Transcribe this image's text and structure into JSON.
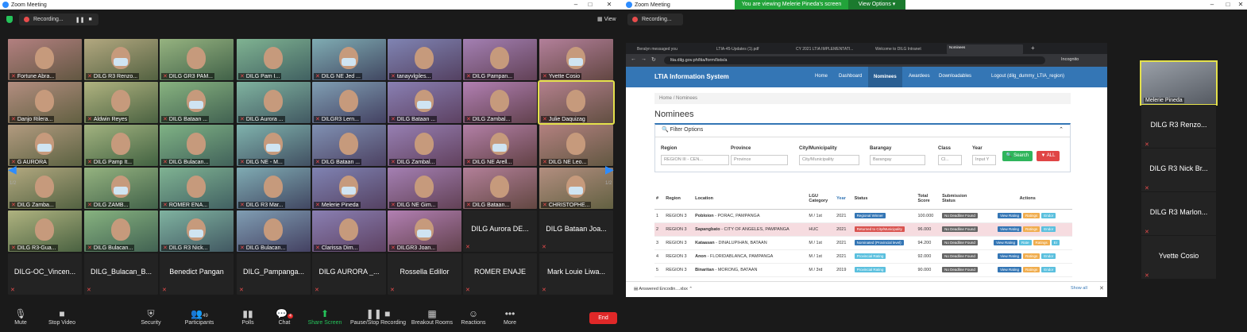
{
  "left": {
    "title": "Zoom Meeting",
    "recording": "Recording...",
    "view": "View",
    "page_left": "1/2",
    "page_right": "1/2",
    "video_tiles": [
      "Fortune Abra...",
      "DILG R3 Renzo...",
      "DILG GR3 PAM...",
      "DILG Pam I...",
      "DILG NE Jed ...",
      "tanayvlgiles...",
      "DILG Pampan...",
      "Yvette Cosio",
      "Danjo Rilera...",
      "Aldwin Reyes",
      "DILG Bataan ...",
      "DILG Aurora ...",
      "DILGR3 Lern...",
      "DILG Bataan ...",
      "DILG Zambal...",
      "Julie Daquizag",
      "G AURORA",
      "DILG Pamp It...",
      "DILG Bulacan...",
      "DILG NE - M...",
      "DILG Bataan ...",
      "DILG Zambal...",
      "DILG NE Arell...",
      "DILG NE Leo...",
      "DILG Zamba...",
      "DILG ZAMB...",
      "ROMER ENA...",
      "DILG R3 Mar...",
      "Melerie Pineda",
      "DILG NE Gim...",
      "DILG Bataan...",
      "CHRISTOPHE...",
      "DILG R3-Gua...",
      "DILG Bulacan...",
      "DILG R3 Nick...",
      "DILG Bulacan...",
      "Clarissa Dim...",
      "DILGR3 Joan..."
    ],
    "name_tiles": [
      "DILG Aurora DE...",
      "DILG Bataan Joa...",
      "DILG-OC_Vincen...",
      "DILG_Bulacan_B...",
      "Benedict Pangan",
      "DILG_Pampanga...",
      "DILG AURORA _...",
      "Rossella Edillor",
      "ROMER ENAJE",
      "Mark Louie Liwa..."
    ],
    "toolbar": {
      "mute": "Mute",
      "stop_video": "Stop Video",
      "security": "Security",
      "participants": "Participants",
      "participants_count": "49",
      "polls": "Polls",
      "chat": "Chat",
      "chat_badge": "4",
      "share_screen": "Share Screen",
      "pause_recording": "Pause/Stop Recording",
      "breakout": "Breakout Rooms",
      "reactions": "Reactions",
      "more": "More",
      "end": "End"
    }
  },
  "right": {
    "title": "Zoom Meeting",
    "recording": "Recording...",
    "banner": "You are viewing Melerie Pineda's screen",
    "view_options": "View Options",
    "browser": {
      "tabs": [
        "Beralyn messaged you",
        "LTIA-45-Updates (1).pdf",
        "CY 2021 LTIA IMPLEMENTATI...",
        "Welcome to DILG Intranet",
        "Nominees"
      ],
      "url": "ltia.dilg.gov.ph/ltia/form/lists/a",
      "incognito": "Incognito",
      "brand": "LTIA Information System",
      "nav": [
        "Home",
        "Dashboard",
        "Nominees",
        "Awardees",
        "Downloadables",
        "Logout (dilg_dummy_LTIA_region)"
      ],
      "breadcrumb": [
        "Home",
        "/",
        "Nominees"
      ],
      "heading": "Nominees",
      "filter_title": "Filter Options",
      "filters": [
        {
          "label": "Region",
          "value": "REGION III - CEN..."
        },
        {
          "label": "Province",
          "value": "Province"
        },
        {
          "label": "City/Municipality",
          "value": "City/Municipality"
        },
        {
          "label": "Barangay",
          "value": "Barangay"
        },
        {
          "label": "Class",
          "value": "Cl..."
        },
        {
          "label": "Year",
          "value": "Input Y"
        }
      ],
      "search_btn": "Search",
      "all_btn": "ALL",
      "columns": [
        "#",
        "Region",
        "Location",
        "LGU Category",
        "Year",
        "Status",
        "Total Score",
        "Submission Status",
        "Actions"
      ],
      "rows": [
        {
          "n": "1",
          "region": "REGION 3",
          "loc_bold": "Pobloion",
          "loc": " - PORAC, PAMPANGA",
          "cat": "M / 1st",
          "year": "2021",
          "status": "Regional Winner",
          "status_color": "#3476b5",
          "score": "100.000",
          "sub": "No Deadline Found",
          "actions": [
            "View Rating",
            "Ratings",
            "Endor"
          ]
        },
        {
          "n": "2",
          "region": "REGION 3",
          "loc_bold": "Sapangbato",
          "loc": " - CITY OF ANGELES, PAMPANGA",
          "cat": "HUC",
          "year": "2021",
          "status": "Returned to City/Municipality",
          "status_color": "#d9534f",
          "score": "96.000",
          "sub": "No Deadline Found",
          "actions": [
            "View Rating",
            "Ratings",
            "Endor"
          ]
        },
        {
          "n": "3",
          "region": "REGION 3",
          "loc_bold": "Kataasan",
          "loc": " - DINALUPIHAN, BATAAN",
          "cat": "M / 1st",
          "year": "2021",
          "status": "Nominated (Provincial level)",
          "status_color": "#3476b5",
          "score": "94.200",
          "sub": "No Deadline Found",
          "actions": [
            "View Rating",
            "Rate",
            "Ratings",
            "Er"
          ]
        },
        {
          "n": "4",
          "region": "REGION 3",
          "loc_bold": "Anon",
          "loc": " - FLORIDABLANCA, PAMPANGA",
          "cat": "M / 1st",
          "year": "2021",
          "status": "Provincial Rating",
          "status_color": "#5bc0de",
          "score": "92.000",
          "sub": "No Deadline Found",
          "actions": [
            "View Rating",
            "Ratings",
            "Endor"
          ]
        },
        {
          "n": "5",
          "region": "REGION 3",
          "loc_bold": "Binaritan",
          "loc": " - MORONG, BATAAN",
          "cat": "M / 3rd",
          "year": "2019",
          "status": "Provincial Rating",
          "status_color": "#5bc0de",
          "score": "90.000",
          "sub": "No Deadline Found",
          "actions": [
            "View Rating",
            "Ratings",
            "Endor"
          ]
        }
      ],
      "download": "Answered Encodin....xlsx",
      "show_all": "Show all"
    },
    "side": {
      "video_name": "Melerie Pineda",
      "names": [
        "DILG R3 Renzo...",
        "DILG R3 Nick Br...",
        "DILG R3 Marlon...",
        "Yvette Cosio"
      ]
    }
  }
}
